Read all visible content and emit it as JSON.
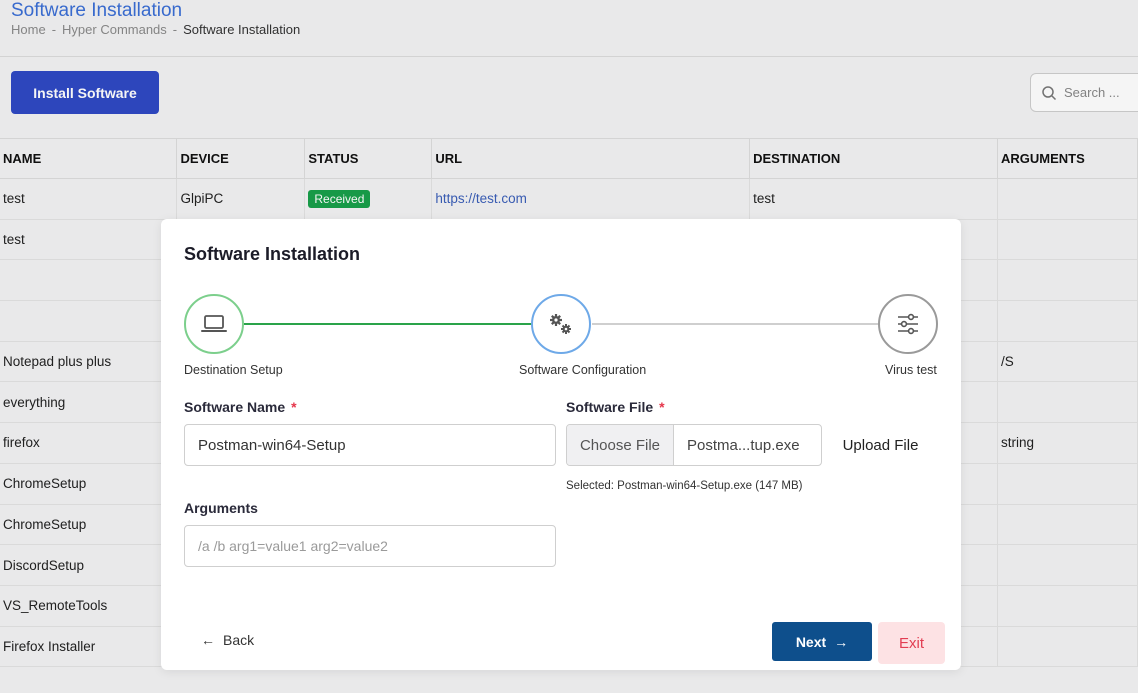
{
  "header": {
    "title": "Software Installation",
    "breadcrumb": [
      "Home",
      "Hyper Commands",
      "Software Installation"
    ],
    "separator": "-"
  },
  "toolbar": {
    "install_label": "Install Software",
    "search_placeholder": "Search ...",
    "search_icon": "search-icon"
  },
  "table": {
    "columns": [
      "NAME",
      "DEVICE",
      "STATUS",
      "URL",
      "DESTINATION",
      "ARGUMENTS"
    ],
    "rows": [
      {
        "name": "test",
        "device": "GlpiPC",
        "status": "Received",
        "url": "https://test.com",
        "destination": "test",
        "arguments": ""
      },
      {
        "name": "test",
        "device": "",
        "status": "",
        "url": "",
        "destination": "",
        "arguments": ""
      },
      {
        "name": "",
        "device": "",
        "status": "",
        "url": "",
        "destination": "",
        "arguments": ""
      },
      {
        "name": "",
        "device": "",
        "status": "",
        "url": "",
        "destination": "",
        "arguments": ""
      },
      {
        "name": "Notepad plus plus",
        "device": "",
        "status": "",
        "url": "",
        "destination": "",
        "arguments": "/S"
      },
      {
        "name": "everything",
        "device": "",
        "status": "",
        "url": "",
        "destination": "",
        "arguments": ""
      },
      {
        "name": "firefox",
        "device": "",
        "status": "",
        "url": "",
        "destination": "",
        "arguments": "string"
      },
      {
        "name": "ChromeSetup",
        "device": "",
        "status": "",
        "url": "",
        "destination": "",
        "arguments": ""
      },
      {
        "name": "ChromeSetup",
        "device": "",
        "status": "",
        "url": "",
        "destination": "",
        "arguments": ""
      },
      {
        "name": "DiscordSetup",
        "device": "",
        "status": "",
        "url": "",
        "destination": "",
        "arguments": ""
      },
      {
        "name": "VS_RemoteTools",
        "device": "",
        "status": "",
        "url": "",
        "destination": "",
        "arguments": ""
      },
      {
        "name": "Firefox Installer",
        "device": "",
        "status": "",
        "url": "",
        "destination": "",
        "arguments": ""
      }
    ],
    "status_color": "#18a04a"
  },
  "modal": {
    "title": "Software Installation",
    "steps": [
      {
        "label": "Destination Setup",
        "icon": "laptop-icon",
        "state": "done"
      },
      {
        "label": "Software Configuration",
        "icon": "gears-icon",
        "state": "active"
      },
      {
        "label": "Virus test",
        "icon": "sliders-icon",
        "state": "pending"
      }
    ],
    "software_name": {
      "label": "Software Name",
      "required": "*",
      "value": "Postman-win64-Setup"
    },
    "software_file": {
      "label": "Software File",
      "required": "*",
      "choose_label": "Choose File",
      "file_display": "Postma...tup.exe",
      "upload_label": "Upload File",
      "selected_note": "Selected: Postman-win64-Setup.exe (147 MB)"
    },
    "arguments": {
      "label": "Arguments",
      "value": "",
      "placeholder": "/a /b arg1=value1 arg2=value2"
    },
    "back_label": "Back",
    "back_arrow": "←",
    "next_label": "Next",
    "next_arrow": "→",
    "exit_label": "Exit"
  },
  "colors": {
    "primary": "#2f49c4",
    "next": "#0e4f8c",
    "exit_bg": "#fde2e4",
    "exit_text": "#e23d52",
    "step_done": "#2aa34a",
    "step_active": "#6ea9e8"
  }
}
